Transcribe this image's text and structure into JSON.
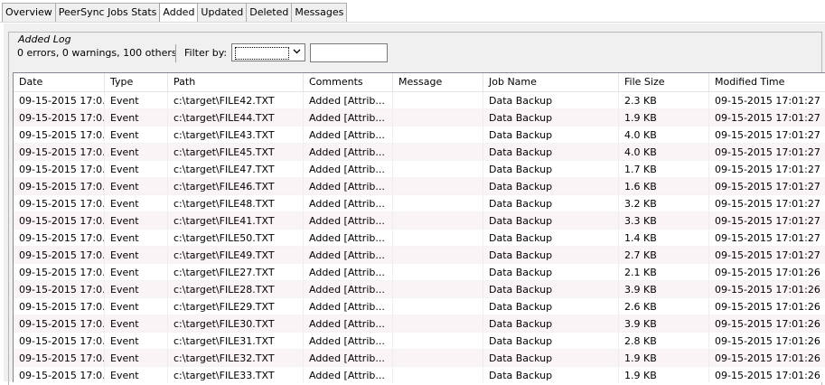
{
  "tabs": [
    {
      "label": "Overview",
      "active": false
    },
    {
      "label": "PeerSync Jobs Stats",
      "active": false
    },
    {
      "label": "Added",
      "active": true
    },
    {
      "label": "Updated",
      "active": false
    },
    {
      "label": "Deleted",
      "active": false
    },
    {
      "label": "Messages",
      "active": false
    }
  ],
  "group": {
    "title": "Added Log"
  },
  "status": {
    "summary": "0 errors, 0 warnings, 100 others"
  },
  "filter": {
    "label": "Filter by:",
    "selected": "",
    "text": ""
  },
  "table": {
    "columns": [
      "Date",
      "Type",
      "Path",
      "Comments",
      "Message",
      "Job Name",
      "File Size",
      "Modified Time"
    ],
    "rows": [
      [
        "09-15-2015 17:0...",
        "Event",
        "c:\\target\\FILE42.TXT",
        "Added [Attrib...",
        "",
        "Data Backup",
        "2.3 KB",
        "09-15-2015 17:01:27"
      ],
      [
        "09-15-2015 17:0...",
        "Event",
        "c:\\target\\FILE44.TXT",
        "Added [Attrib...",
        "",
        "Data Backup",
        "1.9 KB",
        "09-15-2015 17:01:27"
      ],
      [
        "09-15-2015 17:0...",
        "Event",
        "c:\\target\\FILE43.TXT",
        "Added [Attrib...",
        "",
        "Data Backup",
        "4.0 KB",
        "09-15-2015 17:01:27"
      ],
      [
        "09-15-2015 17:0...",
        "Event",
        "c:\\target\\FILE45.TXT",
        "Added [Attrib...",
        "",
        "Data Backup",
        "4.0 KB",
        "09-15-2015 17:01:27"
      ],
      [
        "09-15-2015 17:0...",
        "Event",
        "c:\\target\\FILE47.TXT",
        "Added [Attrib...",
        "",
        "Data Backup",
        "1.7 KB",
        "09-15-2015 17:01:27"
      ],
      [
        "09-15-2015 17:0...",
        "Event",
        "c:\\target\\FILE46.TXT",
        "Added [Attrib...",
        "",
        "Data Backup",
        "1.6 KB",
        "09-15-2015 17:01:27"
      ],
      [
        "09-15-2015 17:0...",
        "Event",
        "c:\\target\\FILE48.TXT",
        "Added [Attrib...",
        "",
        "Data Backup",
        "3.2 KB",
        "09-15-2015 17:01:27"
      ],
      [
        "09-15-2015 17:0...",
        "Event",
        "c:\\target\\FILE41.TXT",
        "Added [Attrib...",
        "",
        "Data Backup",
        "3.3 KB",
        "09-15-2015 17:01:27"
      ],
      [
        "09-15-2015 17:0...",
        "Event",
        "c:\\target\\FILE50.TXT",
        "Added [Attrib...",
        "",
        "Data Backup",
        "1.4 KB",
        "09-15-2015 17:01:27"
      ],
      [
        "09-15-2015 17:0...",
        "Event",
        "c:\\target\\FILE49.TXT",
        "Added [Attrib...",
        "",
        "Data Backup",
        "2.7 KB",
        "09-15-2015 17:01:27"
      ],
      [
        "09-15-2015 17:0...",
        "Event",
        "c:\\target\\FILE27.TXT",
        "Added [Attrib...",
        "",
        "Data Backup",
        "2.1 KB",
        "09-15-2015 17:01:26"
      ],
      [
        "09-15-2015 17:0...",
        "Event",
        "c:\\target\\FILE28.TXT",
        "Added [Attrib...",
        "",
        "Data Backup",
        "3.9 KB",
        "09-15-2015 17:01:26"
      ],
      [
        "09-15-2015 17:0...",
        "Event",
        "c:\\target\\FILE29.TXT",
        "Added [Attrib...",
        "",
        "Data Backup",
        "2.6 KB",
        "09-15-2015 17:01:26"
      ],
      [
        "09-15-2015 17:0...",
        "Event",
        "c:\\target\\FILE30.TXT",
        "Added [Attrib...",
        "",
        "Data Backup",
        "3.9 KB",
        "09-15-2015 17:01:26"
      ],
      [
        "09-15-2015 17:0...",
        "Event",
        "c:\\target\\FILE31.TXT",
        "Added [Attrib...",
        "",
        "Data Backup",
        "2.8 KB",
        "09-15-2015 17:01:26"
      ],
      [
        "09-15-2015 17:0...",
        "Event",
        "c:\\target\\FILE32.TXT",
        "Added [Attrib...",
        "",
        "Data Backup",
        "1.9 KB",
        "09-15-2015 17:01:26"
      ],
      [
        "09-15-2015 17:0...",
        "Event",
        "c:\\target\\FILE33.TXT",
        "Added [Attrib...",
        "",
        "Data Backup",
        "1.9 KB",
        "09-15-2015 17:01:26"
      ]
    ]
  }
}
